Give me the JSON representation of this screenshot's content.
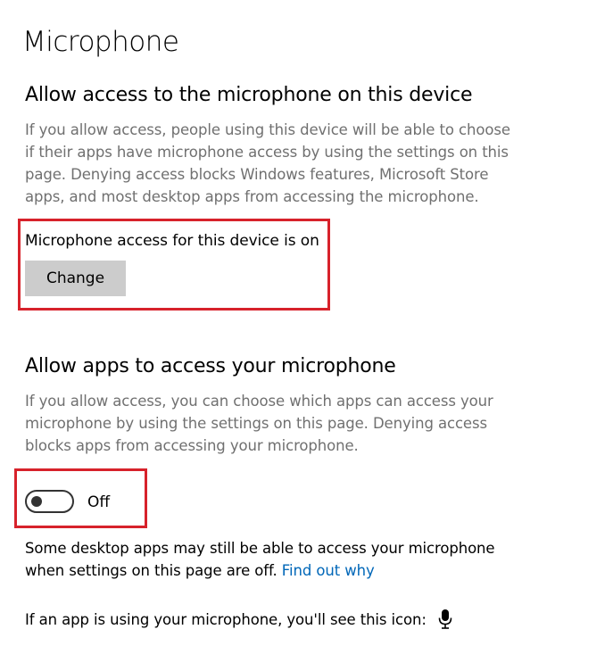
{
  "page": {
    "title": "Microphone"
  },
  "device_section": {
    "heading": "Allow access to the microphone on this device",
    "description_lines": [
      "If you allow access, people using this device will be able to choose",
      "if their apps have microphone access by using the settings on this",
      "page. Denying access blocks Windows features, Microsoft Store",
      "apps, and most desktop apps from accessing the microphone."
    ],
    "status": "Microphone access for this device is on",
    "change_button_label": "Change"
  },
  "apps_section": {
    "heading": "Allow apps to access your microphone",
    "description_lines": [
      "If you allow access, you can choose which apps can access your",
      "microphone by using the settings on this page. Denying access",
      "blocks apps from accessing your microphone."
    ],
    "toggle_state": "Off"
  },
  "desktop_note": {
    "line1": "Some desktop apps may still be able to access your microphone",
    "line2_text": "when settings on this page are off.",
    "link": "Find out why"
  },
  "icon_note": {
    "text": "If an app is using your microphone, you'll see this icon:",
    "icon": "microphone-icon"
  },
  "colors": {
    "highlight": "#d7222b",
    "link": "#0067b8",
    "description": "#707070",
    "button_bg": "#cccccc"
  }
}
